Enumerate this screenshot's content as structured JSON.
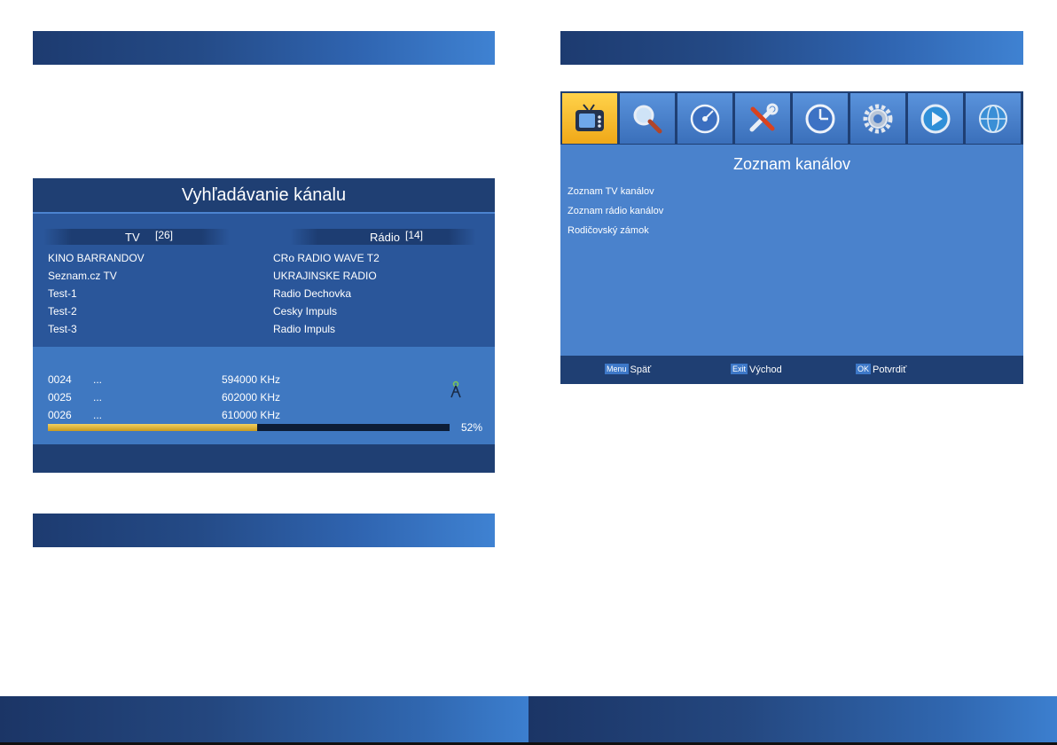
{
  "scan": {
    "title": "Vyhľadávanie kánalu",
    "tv_header": "TV",
    "tv_count": "[26]",
    "radio_header": "Rádio",
    "radio_count": "[14]",
    "tv_channels": [
      "KINO BARRANDOV",
      "Seznam.cz TV",
      "Test-1",
      "Test-2",
      "Test-3"
    ],
    "radio_channels": [
      "CRo RADIO WAVE T2",
      "UKRAJINSKE RADIO",
      "Radio Dechovka",
      "Cesky Impuls",
      "Radio Impuls"
    ],
    "rows": [
      {
        "channel": "0024",
        "dots": "...",
        "freq": "594000 KHz"
      },
      {
        "channel": "0025",
        "dots": "...",
        "freq": "602000 KHz"
      },
      {
        "channel": "0026",
        "dots": "...",
        "freq": "610000 KHz"
      }
    ],
    "progress_value": 52,
    "progress_label": "52%",
    "progress_color": "#e0b030"
  },
  "menu": {
    "tiles": [
      {
        "icon": "tv-icon",
        "active": true
      },
      {
        "icon": "search-icon",
        "active": false
      },
      {
        "icon": "disc-icon",
        "active": false
      },
      {
        "icon": "tools-icon",
        "active": false
      },
      {
        "icon": "clock-icon",
        "active": false
      },
      {
        "icon": "gear-icon",
        "active": false
      },
      {
        "icon": "play-icon",
        "active": false
      },
      {
        "icon": "globe-icon",
        "active": false
      }
    ],
    "title": "Zoznam kanálov",
    "items": [
      "Zoznam TV kanálov",
      "Zoznam rádio kanálov",
      "Rodičovský zámok"
    ],
    "footer": {
      "back_badge": "Menu",
      "back_label": "Späť",
      "exit_badge": "Exit",
      "exit_label": "Východ",
      "ok_badge": "OK",
      "ok_label": "Potvrdiť"
    },
    "accent_color": "#f5b82a"
  }
}
